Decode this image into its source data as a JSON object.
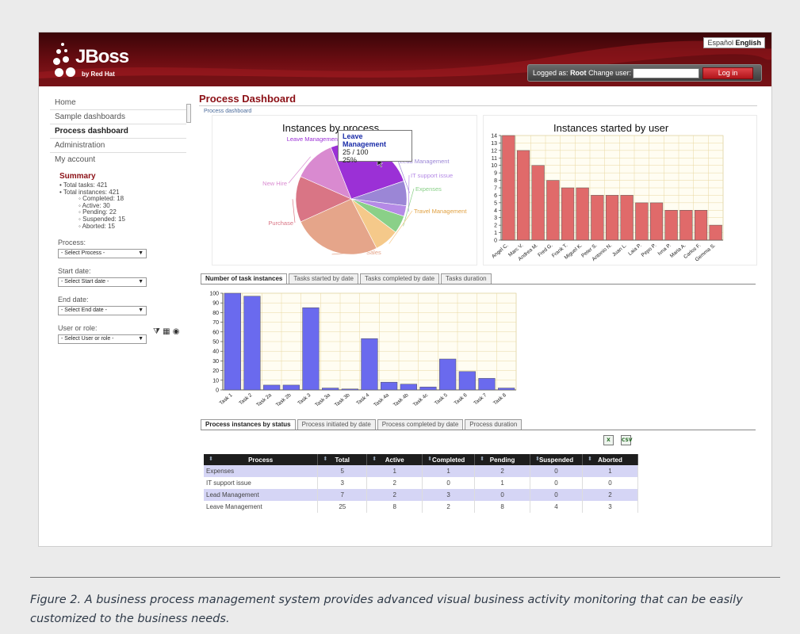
{
  "header": {
    "logo_text": "JBoss",
    "logo_sub": "by Red Hat",
    "lang_es": "Español",
    "lang_en": "English",
    "logged_as_label": "Logged as:",
    "logged_user": "Root",
    "change_user_label": "Change user:",
    "login_button": "Log in"
  },
  "sidebar": {
    "nav": [
      "Home",
      "Sample dashboards",
      "Process dashboard",
      "Administration",
      "My account"
    ],
    "summary_title": "Summary",
    "total_tasks": "Total tasks: 421",
    "total_instances": "Total instances: 421",
    "completed": "Completed: 18",
    "active": "Active: 30",
    "pending": "Pending: 22",
    "suspended": "Suspended: 15",
    "aborted": "Aborted: 15",
    "filters": [
      {
        "label": "Process:",
        "value": "- Select Process -"
      },
      {
        "label": "Start date:",
        "value": "- Select Start date -"
      },
      {
        "label": "End date:",
        "value": "- Select End date -"
      },
      {
        "label": "User or role:",
        "value": "- Select User or role -"
      }
    ]
  },
  "main": {
    "title": "Process Dashboard",
    "breadcrumb": "Process dashboard",
    "tabs1": [
      "Number of task instances",
      "Tasks started by date",
      "Tasks completed by date",
      "Tasks duration"
    ],
    "tabs2": [
      "Process instances by status",
      "Process initiated by date",
      "Process completed by date",
      "Process duration"
    ]
  },
  "chart_data": [
    {
      "type": "pie",
      "title": "Instances by process",
      "categories": [
        "Leave Management",
        "Lead Management",
        "IT support issue",
        "Expenses",
        "Travel Management",
        "Sales",
        "Purchase",
        "New Hire"
      ],
      "values": [
        25,
        7,
        3,
        5,
        7,
        25,
        13,
        12
      ],
      "colors": [
        "#9b30d6",
        "#9b86d6",
        "#b58ae6",
        "#8ad088",
        "#f5c98a",
        "#e5a58a",
        "#d97585",
        "#d98ad0"
      ],
      "tooltip": {
        "title": "Leave Management",
        "value": "25 / 100",
        "percent": "25%"
      }
    },
    {
      "type": "bar",
      "title": "Instances started by user",
      "categories": [
        "Angel C.",
        "Marc V.",
        "Andrea M.",
        "Fred G.",
        "Frank T.",
        "Miguel K.",
        "Peter S.",
        "Antonio N.",
        "Juan L.",
        "Laia P.",
        "Pepo P.",
        "Ivna P.",
        "Maria A.",
        "Carlos F.",
        "Gemma S."
      ],
      "values": [
        14,
        12,
        10,
        8,
        7,
        7,
        6,
        6,
        6,
        5,
        5,
        4,
        4,
        4,
        2
      ],
      "ylim": [
        0,
        14
      ],
      "yticks": [
        0,
        1,
        2,
        3,
        4,
        5,
        6,
        7,
        8,
        9,
        10,
        11,
        12,
        13,
        14
      ],
      "color": "#e06a6a"
    },
    {
      "type": "bar",
      "title": "",
      "categories": [
        "Task 1",
        "Task 2",
        "Task 2a",
        "Task 2b",
        "Task 3",
        "Task 3a",
        "Task 3b",
        "Task 4",
        "Task 4a",
        "Task 4b",
        "Task 4c",
        "Task 5",
        "Task 6",
        "Task 7",
        "Task 8"
      ],
      "values": [
        100,
        97,
        5,
        5,
        85,
        2,
        1,
        53,
        8,
        6,
        3,
        32,
        19,
        12,
        2
      ],
      "ylim": [
        0,
        100
      ],
      "yticks": [
        0,
        10,
        20,
        30,
        40,
        50,
        60,
        70,
        80,
        90,
        100
      ],
      "color": "#6a6aee"
    },
    {
      "type": "table",
      "columns": [
        "Process",
        "Total",
        "Active",
        "Completed",
        "Pending",
        "Suspended",
        "Aborted"
      ],
      "rows": [
        [
          "Expenses",
          "5",
          "1",
          "1",
          "2",
          "0",
          "1"
        ],
        [
          "IT support issue",
          "3",
          "2",
          "0",
          "1",
          "0",
          "0"
        ],
        [
          "Lead Management",
          "7",
          "2",
          "3",
          "0",
          "0",
          "2"
        ],
        [
          "Leave Management",
          "25",
          "8",
          "2",
          "8",
          "4",
          "3"
        ]
      ]
    }
  ],
  "icons": {
    "excel": "excel-export-icon",
    "csv": "csv-export-icon",
    "csv_label": "CSV",
    "sort": "sort-icon"
  },
  "caption": "Figure 2. A business process management system provides advanced visual business activity monitoring that can be easily customized to the business needs."
}
